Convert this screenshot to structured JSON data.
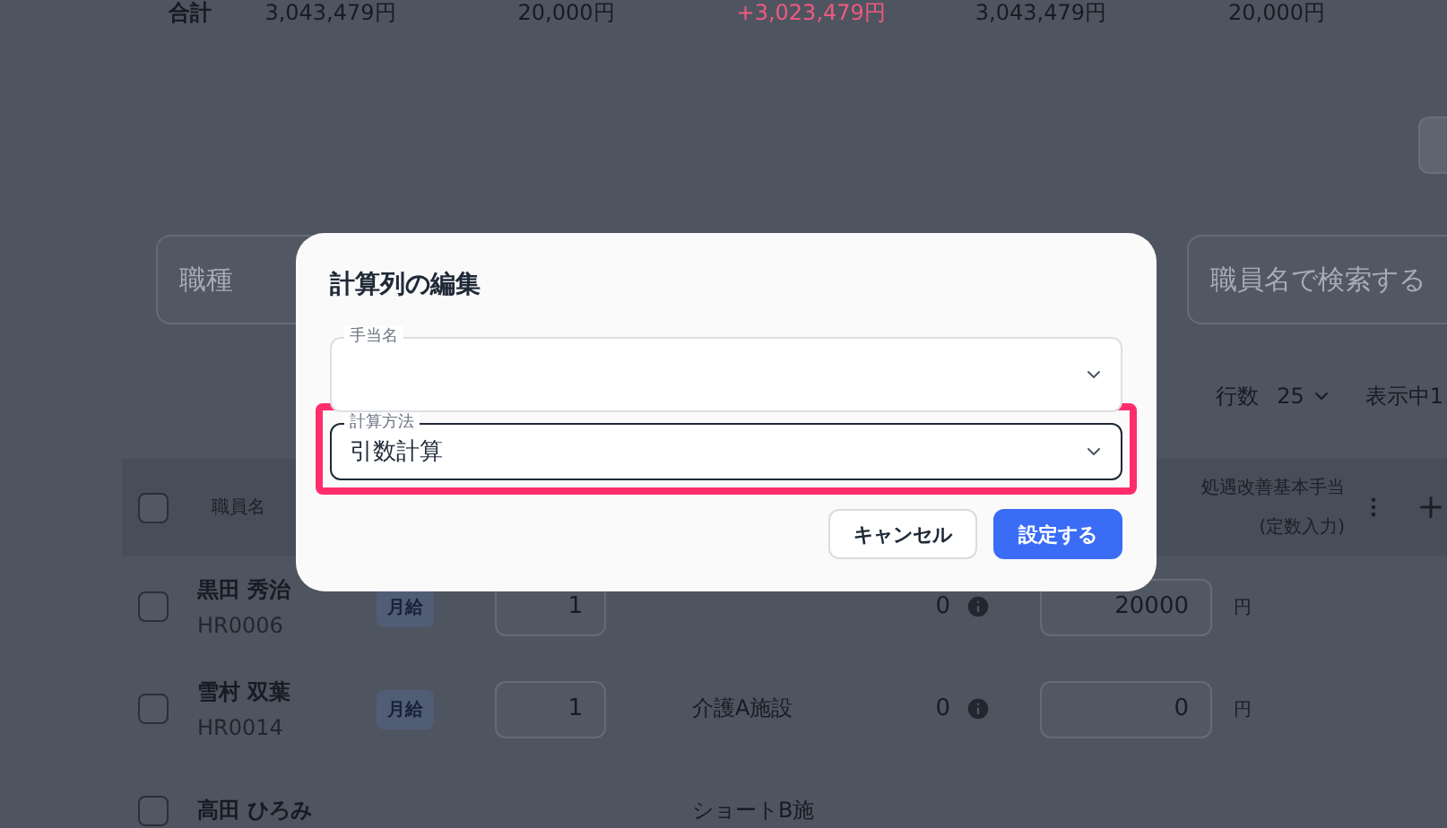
{
  "totals": {
    "label": "合計",
    "values": [
      {
        "text": "3,043,479円",
        "kind": "normal"
      },
      {
        "text": "20,000円",
        "kind": "normal"
      },
      {
        "text": "+3,023,479円",
        "kind": "positive"
      },
      {
        "text": "3,043,479円",
        "kind": "normal"
      },
      {
        "text": "20,000円",
        "kind": "normal"
      }
    ]
  },
  "filters": {
    "job_type": {
      "placeholder": "職種"
    },
    "search": {
      "placeholder": "職員名で検索する"
    }
  },
  "pagination": {
    "rows_label": "行数",
    "rows_value": "25",
    "showing": "表示中1"
  },
  "table": {
    "all_checked": false,
    "columns": [
      {
        "label": "職員名"
      },
      {
        "label": "処遇改善基本手当",
        "sub": "(定数入力)"
      }
    ],
    "rows": [
      {
        "checked": false,
        "name": "黒田 秀治",
        "id": "HR0006",
        "pay_type": "月給",
        "count": "1",
        "value": "0",
        "allowance": "20000",
        "unit": "円"
      },
      {
        "checked": false,
        "name": "雪村 双葉",
        "id": "HR0014",
        "pay_type": "月給",
        "count": "1",
        "facility": "介護A施設",
        "value": "0",
        "allowance": "0",
        "unit": "円"
      },
      {
        "checked": false,
        "name": "高田 ひろみ",
        "facility": "ショートB施"
      }
    ]
  },
  "dialog": {
    "title": "計算列の編集",
    "fields": [
      {
        "label": "手当名",
        "highlighted": false,
        "focused": false
      },
      {
        "label": "計算方法",
        "value": "引数計算",
        "highlighted": true,
        "focused": true
      }
    ],
    "buttons": [
      {
        "label": "キャンセル",
        "kind": "secondary"
      },
      {
        "label": "設定する",
        "kind": "primary"
      }
    ]
  }
}
